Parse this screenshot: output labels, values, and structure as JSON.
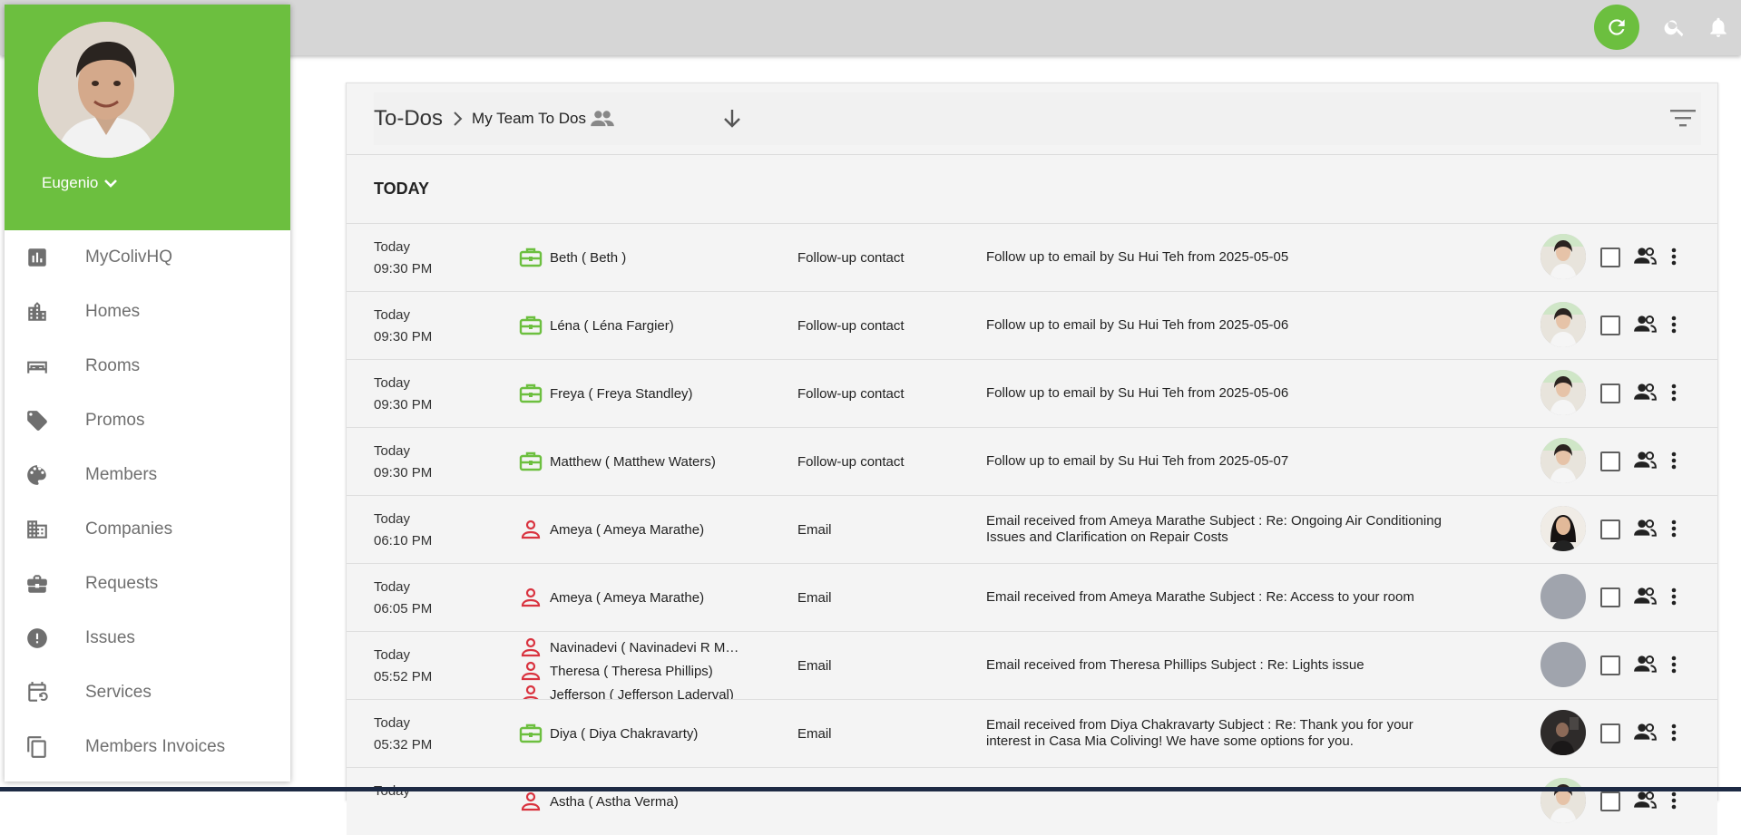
{
  "user": {
    "name": "Eugenio"
  },
  "nav": [
    {
      "label": "MyColivHQ",
      "icon": "bar-chart-icon"
    },
    {
      "label": "Homes",
      "icon": "building-icon"
    },
    {
      "label": "Rooms",
      "icon": "bed-icon"
    },
    {
      "label": "Promos",
      "icon": "tag-icon"
    },
    {
      "label": "Members",
      "icon": "palette-icon"
    },
    {
      "label": "Companies",
      "icon": "company-icon"
    },
    {
      "label": "Requests",
      "icon": "briefcase-icon"
    },
    {
      "label": "Issues",
      "icon": "alert-icon"
    },
    {
      "label": "Services",
      "icon": "calendar-icon"
    },
    {
      "label": "Members Invoices",
      "icon": "copy-icon"
    }
  ],
  "header": {
    "title": "To-Dos",
    "subtitle": "My Team To Dos"
  },
  "section": {
    "label": "TODAY"
  },
  "colors": {
    "green": "#6cbf3f",
    "red": "#d9333f",
    "gray": "#6f6f6f"
  },
  "todos": [
    {
      "day": "Today",
      "time": "09:30 PM",
      "contacts": [
        {
          "name": "Beth ( Beth )",
          "icon": "briefcase-icon"
        }
      ],
      "type": "Follow-up contact",
      "desc": "Follow up to email by Su Hui Teh from 2025-05-05",
      "avatar": "woman-photo"
    },
    {
      "day": "Today",
      "time": "09:30 PM",
      "contacts": [
        {
          "name": "Léna ( Léna Fargier)",
          "icon": "briefcase-icon"
        }
      ],
      "type": "Follow-up contact",
      "desc": "Follow up to email by Su Hui Teh from 2025-05-06",
      "avatar": "woman-photo"
    },
    {
      "day": "Today",
      "time": "09:30 PM",
      "contacts": [
        {
          "name": "Freya ( Freya Standley)",
          "icon": "briefcase-icon"
        }
      ],
      "type": "Follow-up contact",
      "desc": "Follow up to email by Su Hui Teh from 2025-05-06",
      "avatar": "woman-photo"
    },
    {
      "day": "Today",
      "time": "09:30 PM",
      "contacts": [
        {
          "name": "Matthew ( Matthew Waters)",
          "icon": "briefcase-icon"
        }
      ],
      "type": "Follow-up contact",
      "desc": "Follow up to email by Su Hui Teh from 2025-05-07",
      "avatar": "woman-photo"
    },
    {
      "day": "Today",
      "time": "06:10 PM",
      "contacts": [
        {
          "name": "Ameya ( Ameya Marathe)",
          "icon": "person-icon"
        }
      ],
      "type": "Email",
      "desc": "Email received from Ameya Marathe Subject : Re: Ongoing Air Conditioning Issues and Clarification on Repair Costs",
      "avatar": "woman-dark-photo"
    },
    {
      "day": "Today",
      "time": "06:05 PM",
      "contacts": [
        {
          "name": "Ameya ( Ameya Marathe)",
          "icon": "person-icon"
        }
      ],
      "type": "Email",
      "desc": "Email received from Ameya Marathe Subject : Re: Access to your room",
      "avatar": "placeholder"
    },
    {
      "day": "Today",
      "time": "05:52 PM",
      "contacts": [
        {
          "name": "Navinadevi  ( Navinadevi  R M…",
          "icon": "person-icon"
        },
        {
          "name": "Theresa ( Theresa Phillips)",
          "icon": "person-icon"
        },
        {
          "name": "Jefferson ( Jefferson Laderval)",
          "icon": "person-icon"
        }
      ],
      "type": "Email",
      "desc": "Email received from Theresa Phillips Subject : Re: Lights issue",
      "avatar": "placeholder"
    },
    {
      "day": "Today",
      "time": "05:32 PM",
      "contacts": [
        {
          "name": "Diya ( Diya Chakravarty)",
          "icon": "briefcase-icon"
        }
      ],
      "type": "Email",
      "desc": "Email received from Diya Chakravarty Subject : Re: Thank you for your interest in Casa Mia Coliving! We have some options for you.",
      "avatar": "dark-photo"
    },
    {
      "day": "Today",
      "time": "",
      "contacts": [
        {
          "name": "Astha ( Astha Verma)",
          "icon": "person-icon"
        }
      ],
      "type": "",
      "desc": "",
      "avatar": "woman-photo"
    }
  ]
}
